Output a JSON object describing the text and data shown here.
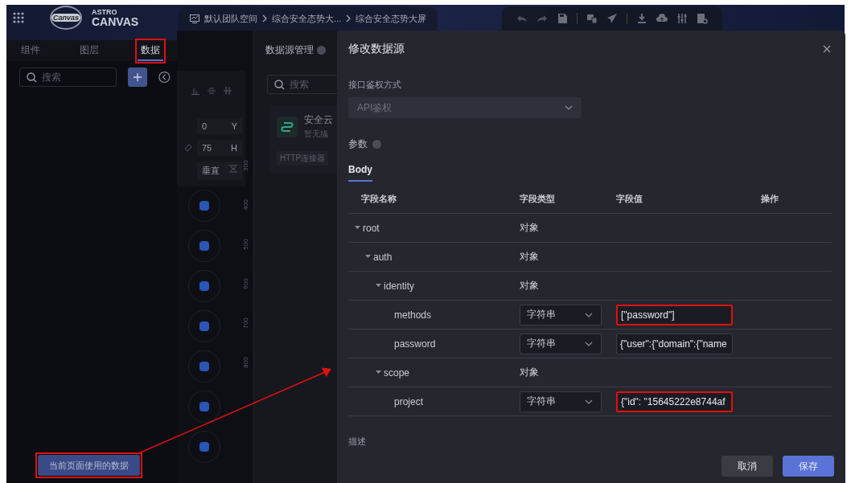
{
  "header": {
    "logo_badge": "Canvas",
    "brand_top": "ASTRO",
    "brand_name": "CANVAS",
    "breadcrumb": [
      "默认团队空间",
      "综合安全态势大...",
      "综合安全态势大屏"
    ]
  },
  "left_panel": {
    "tabs": [
      {
        "label": "组件",
        "selected": false,
        "highlighted": false
      },
      {
        "label": "图层",
        "selected": false,
        "highlighted": false
      },
      {
        "label": "数据",
        "selected": true,
        "highlighted": true
      }
    ],
    "search": {
      "placeholder": "搜索"
    },
    "footer_button": {
      "label": "当前页面使用的数据",
      "highlighted": true
    }
  },
  "canvas": {
    "props": [
      {
        "value": "0",
        "axis": "Y"
      },
      {
        "value": "75",
        "axis": "H"
      }
    ],
    "direction": "垂直",
    "ruler": [
      "300",
      "400",
      "500",
      "600",
      "700",
      "800"
    ]
  },
  "datasource_panel": {
    "title": "数据源管理",
    "search": {
      "placeholder": "搜索"
    },
    "card": {
      "name": "安全云",
      "description": "暂无描",
      "tag": "HTTP连接器"
    }
  },
  "modal": {
    "title": "修改数据源",
    "auth_label": "接口鉴权方式",
    "auth_select": {
      "value": "API鉴权",
      "disabled": true
    },
    "params_label": "参数",
    "tabs": [
      {
        "label": "Body",
        "selected": true
      }
    ],
    "columns": [
      "字段名称",
      "字段类型",
      "字段值",
      "操作"
    ],
    "rows": [
      {
        "name": "root",
        "kind": "object",
        "type": "对象",
        "expanded": true,
        "children": [
          {
            "name": "auth",
            "kind": "object",
            "type": "对象",
            "expanded": true,
            "children": [
              {
                "name": "identity",
                "kind": "object",
                "type": "对象",
                "expanded": true,
                "children": [
                  {
                    "name": "methods",
                    "kind": "string",
                    "type": "字符串",
                    "value": "[\"password\"]",
                    "highlighted": true
                  },
                  {
                    "name": "password",
                    "kind": "string",
                    "type": "字符串",
                    "value": "{\"user\":{\"domain\":{\"name",
                    "highlighted": false
                  }
                ]
              },
              {
                "name": "scope",
                "kind": "object",
                "type": "对象",
                "expanded": true,
                "children": [
                  {
                    "name": "project",
                    "kind": "string",
                    "type": "字符串",
                    "value": "{\"id\": \"15645222e8744af",
                    "highlighted": true
                  }
                ]
              }
            ]
          }
        ]
      }
    ],
    "description_label": "描述",
    "buttons": [
      {
        "label": "取消",
        "kind": "secondary"
      },
      {
        "label": "保存",
        "kind": "primary"
      }
    ]
  }
}
